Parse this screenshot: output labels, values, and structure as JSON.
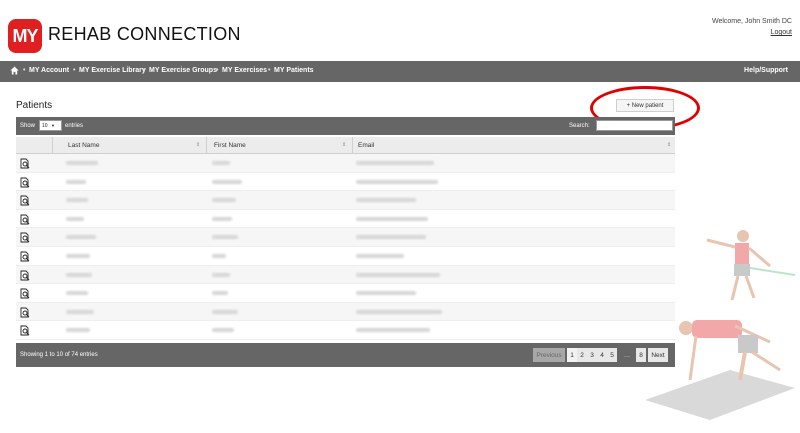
{
  "brand": {
    "logo_mark": "MY",
    "logo_text": "REHAB CONNECTION"
  },
  "user": {
    "welcome": "Welcome, John Smith DC",
    "logout": "Logout"
  },
  "nav": {
    "items": [
      "MY Account",
      "MY Exercise Library",
      "MY Exercise Groups",
      "MY Exercises",
      "MY Patients"
    ],
    "help": "Help/Support",
    "home_icon": "home-icon"
  },
  "page": {
    "title": "Patients",
    "new_button": "+ New patient"
  },
  "table_controls": {
    "show_label": "Show",
    "page_size": "10",
    "entries_label": "entries",
    "search_label": "Search:",
    "search_value": ""
  },
  "table": {
    "columns": [
      "",
      "Last Name",
      "First Name",
      "Email"
    ],
    "row_icon": "edit-patient-icon",
    "rows": [
      {
        "last": "",
        "first": "",
        "email": ""
      },
      {
        "last": "",
        "first": "",
        "email": ""
      },
      {
        "last": "",
        "first": "",
        "email": ""
      },
      {
        "last": "",
        "first": "",
        "email": ""
      },
      {
        "last": "",
        "first": "",
        "email": ""
      },
      {
        "last": "",
        "first": "",
        "email": ""
      },
      {
        "last": "",
        "first": "",
        "email": ""
      },
      {
        "last": "",
        "first": "",
        "email": ""
      },
      {
        "last": "",
        "first": "",
        "email": ""
      },
      {
        "last": "",
        "first": "",
        "email": ""
      }
    ]
  },
  "footer": {
    "info": "Showing 1 to 10 of 74 entries",
    "pagination": {
      "previous": "Previous",
      "pages": [
        "1",
        "2",
        "3",
        "4",
        "5"
      ],
      "ellipsis": "…",
      "last": "8",
      "next": "Next"
    }
  },
  "colors": {
    "brand_red": "#e02020",
    "bar_gray": "#666666",
    "highlight_red": "#e00000"
  }
}
